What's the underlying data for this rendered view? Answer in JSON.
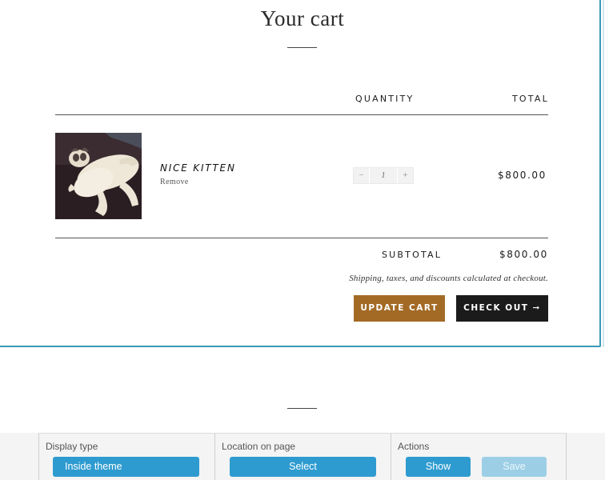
{
  "cart": {
    "title": "Your cart",
    "headers": {
      "quantity": "QUANTITY",
      "total": "TOTAL"
    },
    "item": {
      "name": "NICE KITTEN",
      "remove_label": "Remove",
      "quantity": "1",
      "minus": "−",
      "plus": "+",
      "line_total": "$800.00",
      "image_icon": "cat-photo"
    },
    "subtotal_label": "SUBTOTAL",
    "subtotal_value": "$800.00",
    "shipping_note": "Shipping, taxes, and discounts calculated at checkout.",
    "update_label": "UPDATE CART",
    "checkout_label": "CHECK OUT ➞"
  },
  "toolbar": {
    "display_type": {
      "label": "Display type",
      "value": "Inside theme"
    },
    "location": {
      "label": "Location on page",
      "button": "Select"
    },
    "actions": {
      "label": "Actions",
      "show": "Show",
      "save": "Save"
    }
  },
  "colors": {
    "update_button": "#a36a26",
    "checkout_button": "#1b1b1b",
    "toolbar_button": "#2e9bd0",
    "toolbar_button_disabled": "#9ccfe6",
    "frame_border": "#3a9ab8"
  }
}
